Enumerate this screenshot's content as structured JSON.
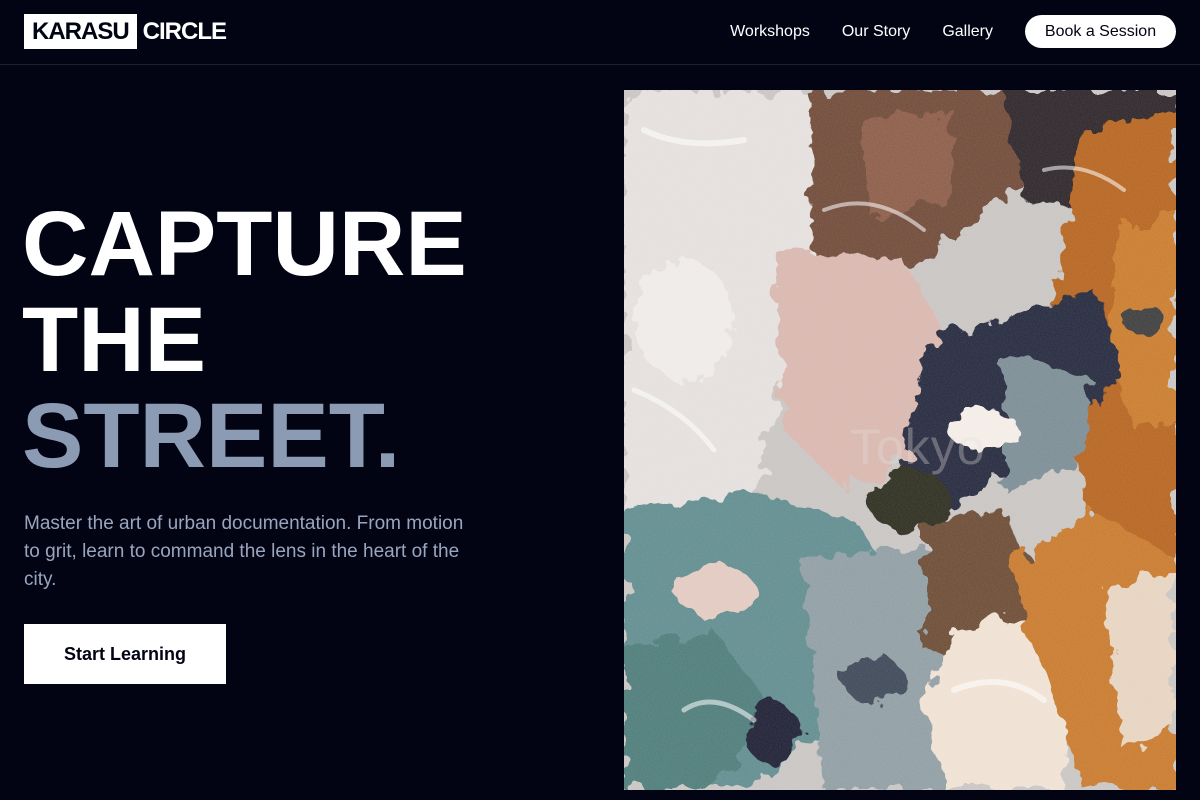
{
  "header": {
    "logo": {
      "box_text": "KARASU",
      "word_text": "CIRCLE"
    },
    "nav": [
      {
        "label": "Workshops"
      },
      {
        "label": "Our Story"
      },
      {
        "label": "Gallery"
      }
    ],
    "cta_label": "Book a Session"
  },
  "hero": {
    "title_lines": [
      "CAPTURE",
      "THE",
      "STREET."
    ],
    "subtitle": "Master the art of urban documentation. From motion to grit, learn to command the lens in the heart of the city.",
    "cta_label": "Start Learning"
  },
  "artwork": {
    "watermark": "Tokyo"
  },
  "colors": {
    "background": "#020414",
    "muted_title": "#8c9bb4",
    "body_text": "#9aa6bf",
    "accent_white": "#ffffff"
  }
}
